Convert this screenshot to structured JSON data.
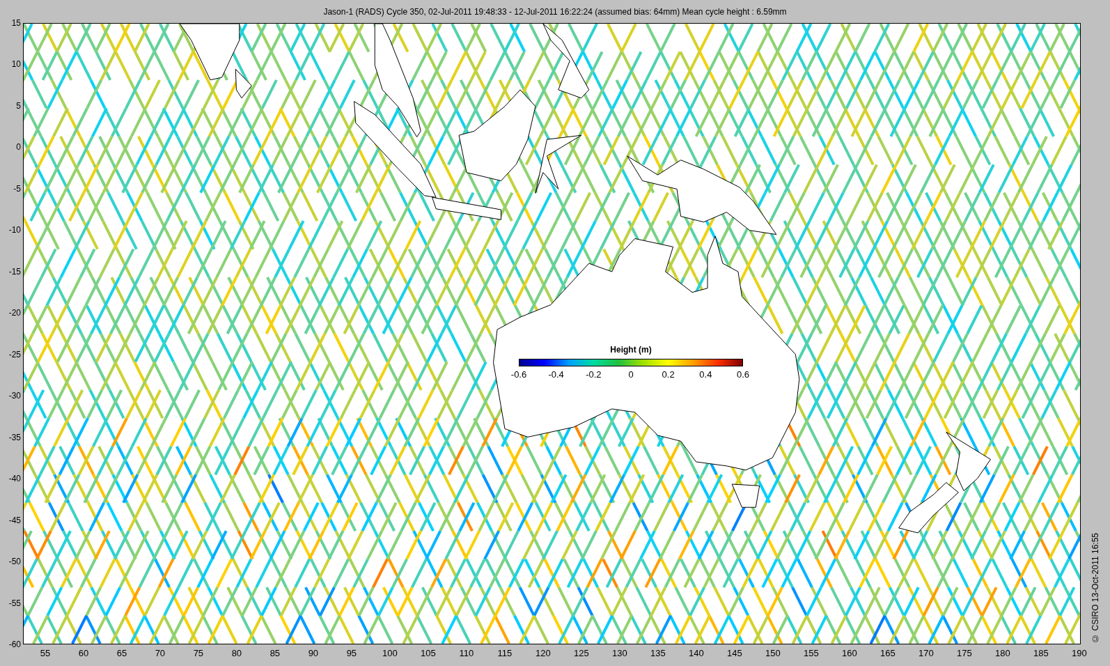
{
  "figure": {
    "title": "Jason-1 (RADS) Cycle 350, 02-Jul-2011 19:48:33 - 12-Jul-2011 16:22:24 (assumed bias: 64mm)  Mean cycle height : 6.59mm",
    "y_ticks": [
      "15",
      "10",
      "5",
      "0",
      "-5",
      "-10",
      "-15",
      "-20",
      "-25",
      "-30",
      "-35",
      "-40",
      "-45",
      "-50",
      "-55",
      "-60"
    ],
    "x_ticks": [
      "55",
      "60",
      "65",
      "70",
      "75",
      "80",
      "85",
      "90",
      "95",
      "100",
      "105",
      "110",
      "115",
      "120",
      "125",
      "130",
      "135",
      "140",
      "145",
      "150",
      "155",
      "160",
      "165",
      "170",
      "175",
      "180",
      "185",
      "190"
    ],
    "colorbar": {
      "title": "Height (m)",
      "ticks": [
        "-0.6",
        "-0.4",
        "-0.2",
        "0",
        "0.2",
        "0.4",
        "0.6"
      ]
    },
    "credit": "© CSIRO 13-Oct-2011 16:55"
  }
}
